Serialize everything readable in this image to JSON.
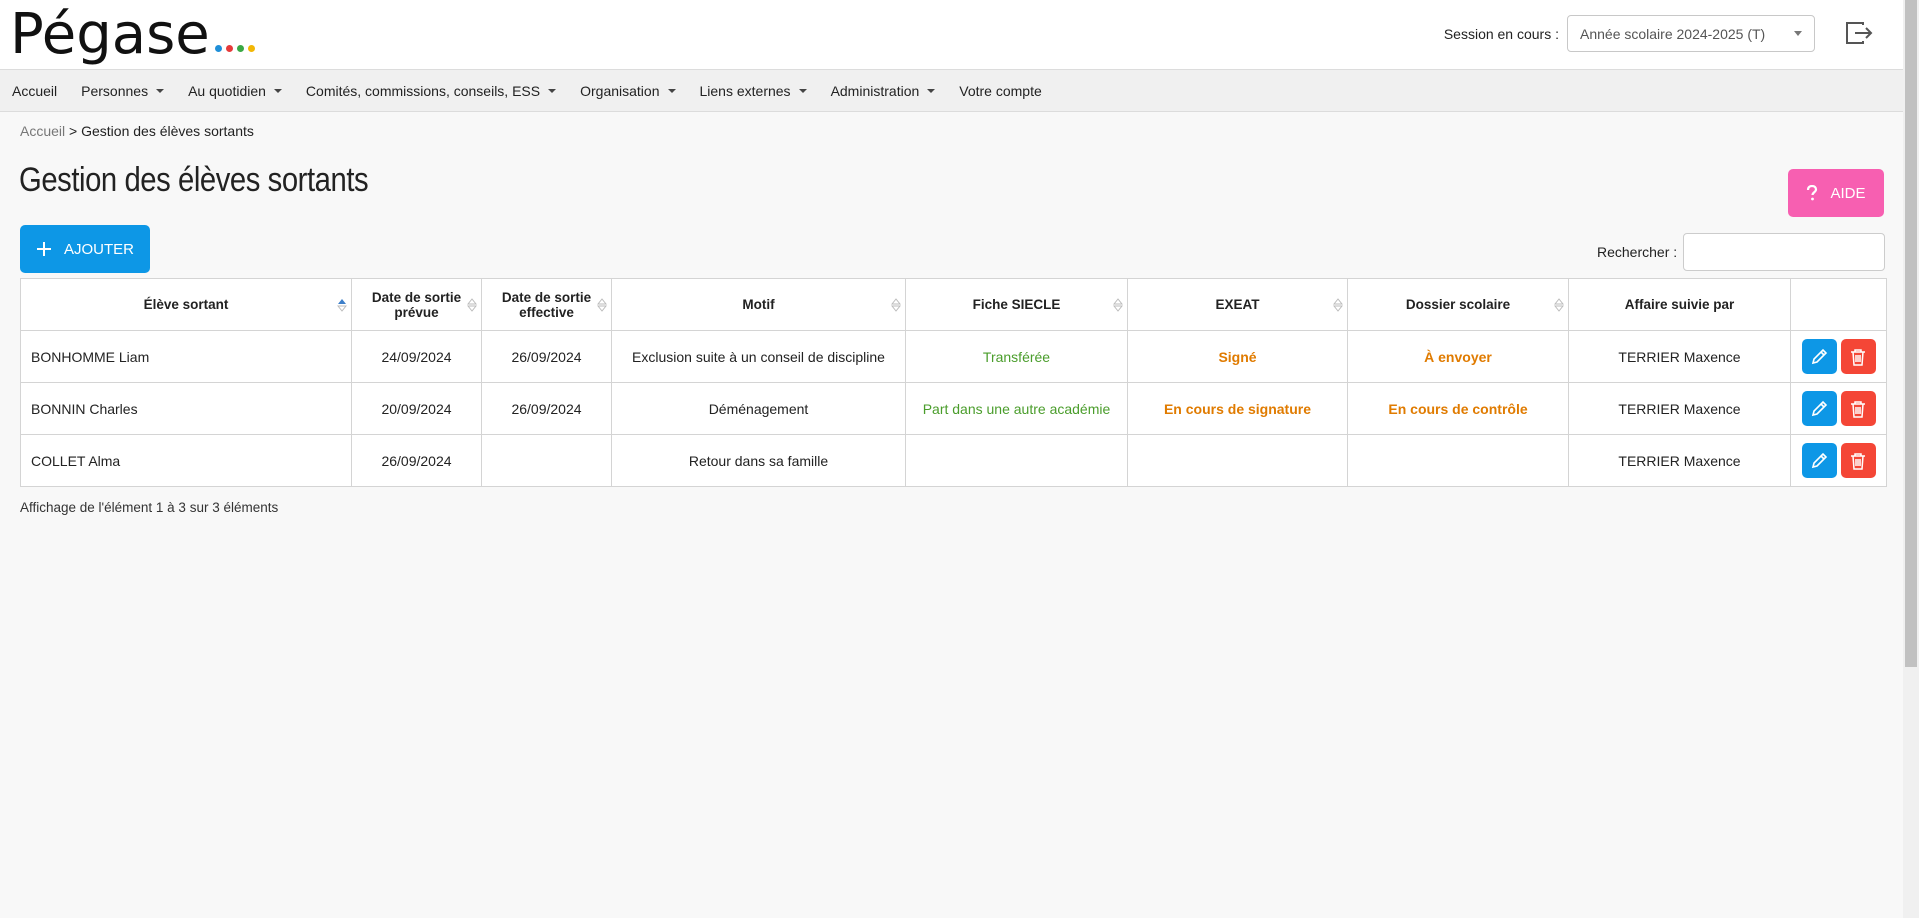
{
  "header": {
    "logo_text": "Pégase",
    "logo_dot_colors": [
      "#1f8fd8",
      "#e63a3a",
      "#3aa845",
      "#f2b705"
    ],
    "session_label": "Session en cours :",
    "session_value": "Année scolaire 2024-2025 (T)"
  },
  "nav": {
    "items": [
      {
        "label": "Accueil",
        "dropdown": false
      },
      {
        "label": "Personnes",
        "dropdown": true
      },
      {
        "label": "Au quotidien",
        "dropdown": true
      },
      {
        "label": "Comités, commissions, conseils, ESS",
        "dropdown": true
      },
      {
        "label": "Organisation",
        "dropdown": true
      },
      {
        "label": "Liens externes",
        "dropdown": true
      },
      {
        "label": "Administration",
        "dropdown": true
      },
      {
        "label": "Votre compte",
        "dropdown": false
      }
    ]
  },
  "breadcrumb": {
    "home": "Accueil",
    "separator": ">",
    "current": "Gestion des élèves sortants"
  },
  "page": {
    "title": "Gestion des élèves sortants",
    "aide_label": "AIDE",
    "add_label": "AJOUTER",
    "search_label": "Rechercher :",
    "search_value": ""
  },
  "table": {
    "headers": [
      "Élève sortant",
      "Date de sortie prévue",
      "Date de sortie effective",
      "Motif",
      "Fiche SIECLE",
      "EXEAT",
      "Dossier scolaire",
      "Affaire suivie par",
      ""
    ],
    "rows": [
      {
        "eleve": "BONHOMME Liam",
        "prevue": "24/09/2024",
        "effective": "26/09/2024",
        "motif": "Exclusion suite à un conseil de discipline",
        "siecle": "Transférée",
        "exeat": "Signé",
        "dossier": "À envoyer",
        "suivi": "TERRIER Maxence"
      },
      {
        "eleve": "BONNIN Charles",
        "prevue": "20/09/2024",
        "effective": "26/09/2024",
        "motif": "Déménagement",
        "siecle": "Part dans une autre académie",
        "exeat": "En cours de signature",
        "dossier": "En cours de contrôle",
        "suivi": "TERRIER Maxence"
      },
      {
        "eleve": "COLLET Alma",
        "prevue": "26/09/2024",
        "effective": "",
        "motif": "Retour dans sa famille",
        "siecle": "",
        "exeat": "",
        "dossier": "",
        "suivi": "TERRIER Maxence"
      }
    ],
    "info": "Affichage de l'élément 1 à 3 sur 3 éléments"
  },
  "colors": {
    "primary": "#0d97e6",
    "aide": "#f75fb1",
    "danger": "#f44636",
    "green": "#4a9d2b",
    "orange": "#e07b00"
  }
}
